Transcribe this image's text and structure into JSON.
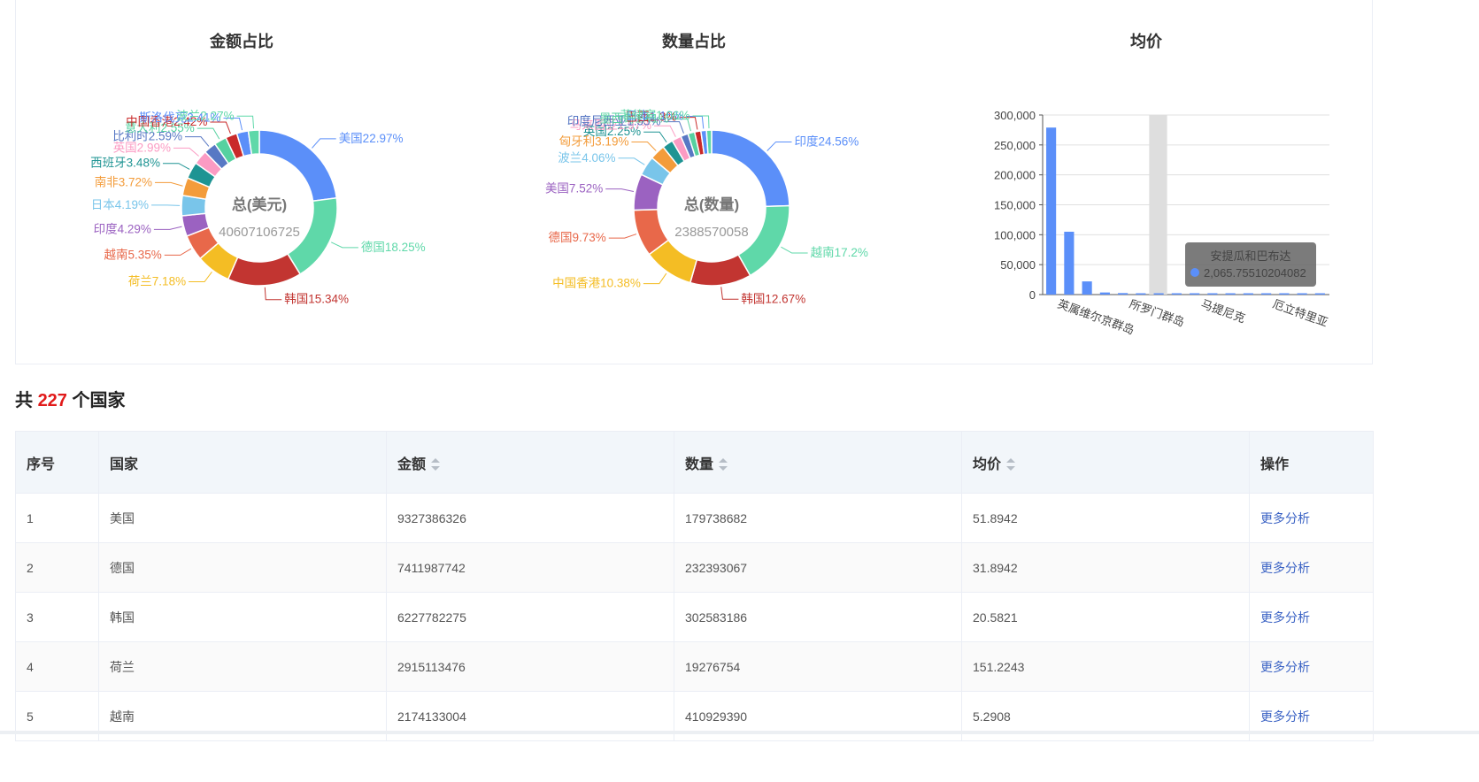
{
  "colors": {
    "palette": [
      "#5b8ff9",
      "#5fd8a9",
      "#c23531",
      "#f4bd24",
      "#e8684a",
      "#9b62c1",
      "#79c5ea",
      "#f39c3b",
      "#1e9493",
      "#fb9bc3",
      "#5878c4",
      "#56d1a0",
      "#c92a2a"
    ],
    "accent_count": "#e11a1a",
    "link": "#3a62c4",
    "header_bg": "#f2f6fa"
  },
  "chart_data": [
    {
      "type": "pie",
      "title": "金额占比",
      "center_label": "总(美元)",
      "center_value": "40607106725",
      "slices": [
        {
          "name": "美国",
          "value": 22.97,
          "label": "美国22.97%"
        },
        {
          "name": "德国",
          "value": 18.25,
          "label": "德国18.25%"
        },
        {
          "name": "韩国",
          "value": 15.34,
          "label": "韩国15.34%"
        },
        {
          "name": "荷兰",
          "value": 7.18,
          "label": "荷兰7.18%"
        },
        {
          "name": "越南",
          "value": 5.35,
          "label": "越南5.35%"
        },
        {
          "name": "印度",
          "value": 4.29,
          "label": "印度4.29%"
        },
        {
          "name": "日本",
          "value": 4.19,
          "label": "日本4.19%"
        },
        {
          "name": "南非",
          "value": 3.72,
          "label": "南非3.72%"
        },
        {
          "name": "西班牙",
          "value": 3.48,
          "label": "西班牙3.48%"
        },
        {
          "name": "英国",
          "value": 2.99,
          "label": "英国2.99%"
        },
        {
          "name": "比利时",
          "value": 2.59,
          "label": "比利时2.59%"
        },
        {
          "name": "意大利",
          "value": 2.55,
          "label": "意大利2.55%"
        },
        {
          "name": "中国香港",
          "value": 2.42,
          "label": "中国香港2.42%"
        },
        {
          "name": "斯洛伐克",
          "value": 2.41,
          "label": "斯洛伐克2.41%"
        },
        {
          "name": "波兰",
          "value": 2.27,
          "label": "波兰2.27%"
        }
      ]
    },
    {
      "type": "pie",
      "title": "数量占比",
      "center_label": "总(数量)",
      "center_value": "2388570058",
      "slices": [
        {
          "name": "印度",
          "value": 24.56,
          "label": "印度24.56%"
        },
        {
          "name": "越南",
          "value": 17.2,
          "label": "越南17.2%"
        },
        {
          "name": "韩国",
          "value": 12.67,
          "label": "韩国12.67%"
        },
        {
          "name": "中国香港",
          "value": 10.38,
          "label": "中国香港10.38%"
        },
        {
          "name": "德国",
          "value": 9.73,
          "label": "德国9.73%"
        },
        {
          "name": "美国",
          "value": 7.52,
          "label": "美国7.52%"
        },
        {
          "name": "波兰",
          "value": 4.06,
          "label": "波兰4.06%"
        },
        {
          "name": "匈牙利",
          "value": 3.19,
          "label": "匈牙利3.19%"
        },
        {
          "name": "英国",
          "value": 2.25,
          "label": "英国2.25%"
        },
        {
          "name": "马来西亚",
          "value": 1.97,
          "label": "马来西亚1.97%"
        },
        {
          "name": "印度尼西亚",
          "value": 1.55,
          "label": "印度尼西亚1.55%"
        },
        {
          "name": "墨西哥",
          "value": 1.41,
          "label": "墨西哥1.41%"
        },
        {
          "name": "巴西",
          "value": 1.3,
          "label": "巴西1.3%"
        },
        {
          "name": "日本",
          "value": 1.15,
          "label": "日本1.15%"
        },
        {
          "name": "菲律宾",
          "value": 1.06,
          "label": "菲律宾1.06%"
        }
      ]
    },
    {
      "type": "bar",
      "title": "均价",
      "ylim": [
        0,
        300000
      ],
      "yticks": [
        "0",
        "50,000",
        "100,000",
        "150,000",
        "200,000",
        "250,000",
        "300,000"
      ],
      "ytick_values": [
        0,
        50000,
        100000,
        150000,
        200000,
        250000,
        300000
      ],
      "xtick_labels": [
        "英属维尔京群岛",
        "所罗门群岛",
        "马提尼克",
        "厄立特里亚"
      ],
      "values": [
        279000,
        105000,
        22000,
        3500,
        2500,
        2065.7551,
        1200,
        1000,
        900,
        800,
        700,
        600,
        500,
        400,
        300,
        250
      ],
      "highlight_index": 5,
      "grid": true,
      "tooltip": {
        "title": "安提瓜和巴布达",
        "value": "2,065.7551020408​2"
      }
    }
  ],
  "summary": {
    "prefix": "共",
    "count": "227",
    "suffix": "个国家"
  },
  "table": {
    "headers": {
      "index": "序号",
      "country": "国家",
      "amount": "金额",
      "quantity": "数量",
      "avg_price": "均价",
      "action": "操作"
    },
    "rows": [
      {
        "index": "1",
        "country": "美国",
        "amount": "9327386326",
        "quantity": "179738682",
        "avg_price": "51.8942",
        "action": "更多分析"
      },
      {
        "index": "2",
        "country": "德国",
        "amount": "7411987742",
        "quantity": "232393067",
        "avg_price": "31.8942",
        "action": "更多分析"
      },
      {
        "index": "3",
        "country": "韩国",
        "amount": "6227782275",
        "quantity": "302583186",
        "avg_price": "20.5821",
        "action": "更多分析"
      },
      {
        "index": "4",
        "country": "荷兰",
        "amount": "2915113476",
        "quantity": "19276754",
        "avg_price": "151.2243",
        "action": "更多分析"
      },
      {
        "index": "5",
        "country": "越南",
        "amount": "2174133004",
        "quantity": "410929390",
        "avg_price": "5.2908",
        "action": "更多分析"
      }
    ]
  }
}
